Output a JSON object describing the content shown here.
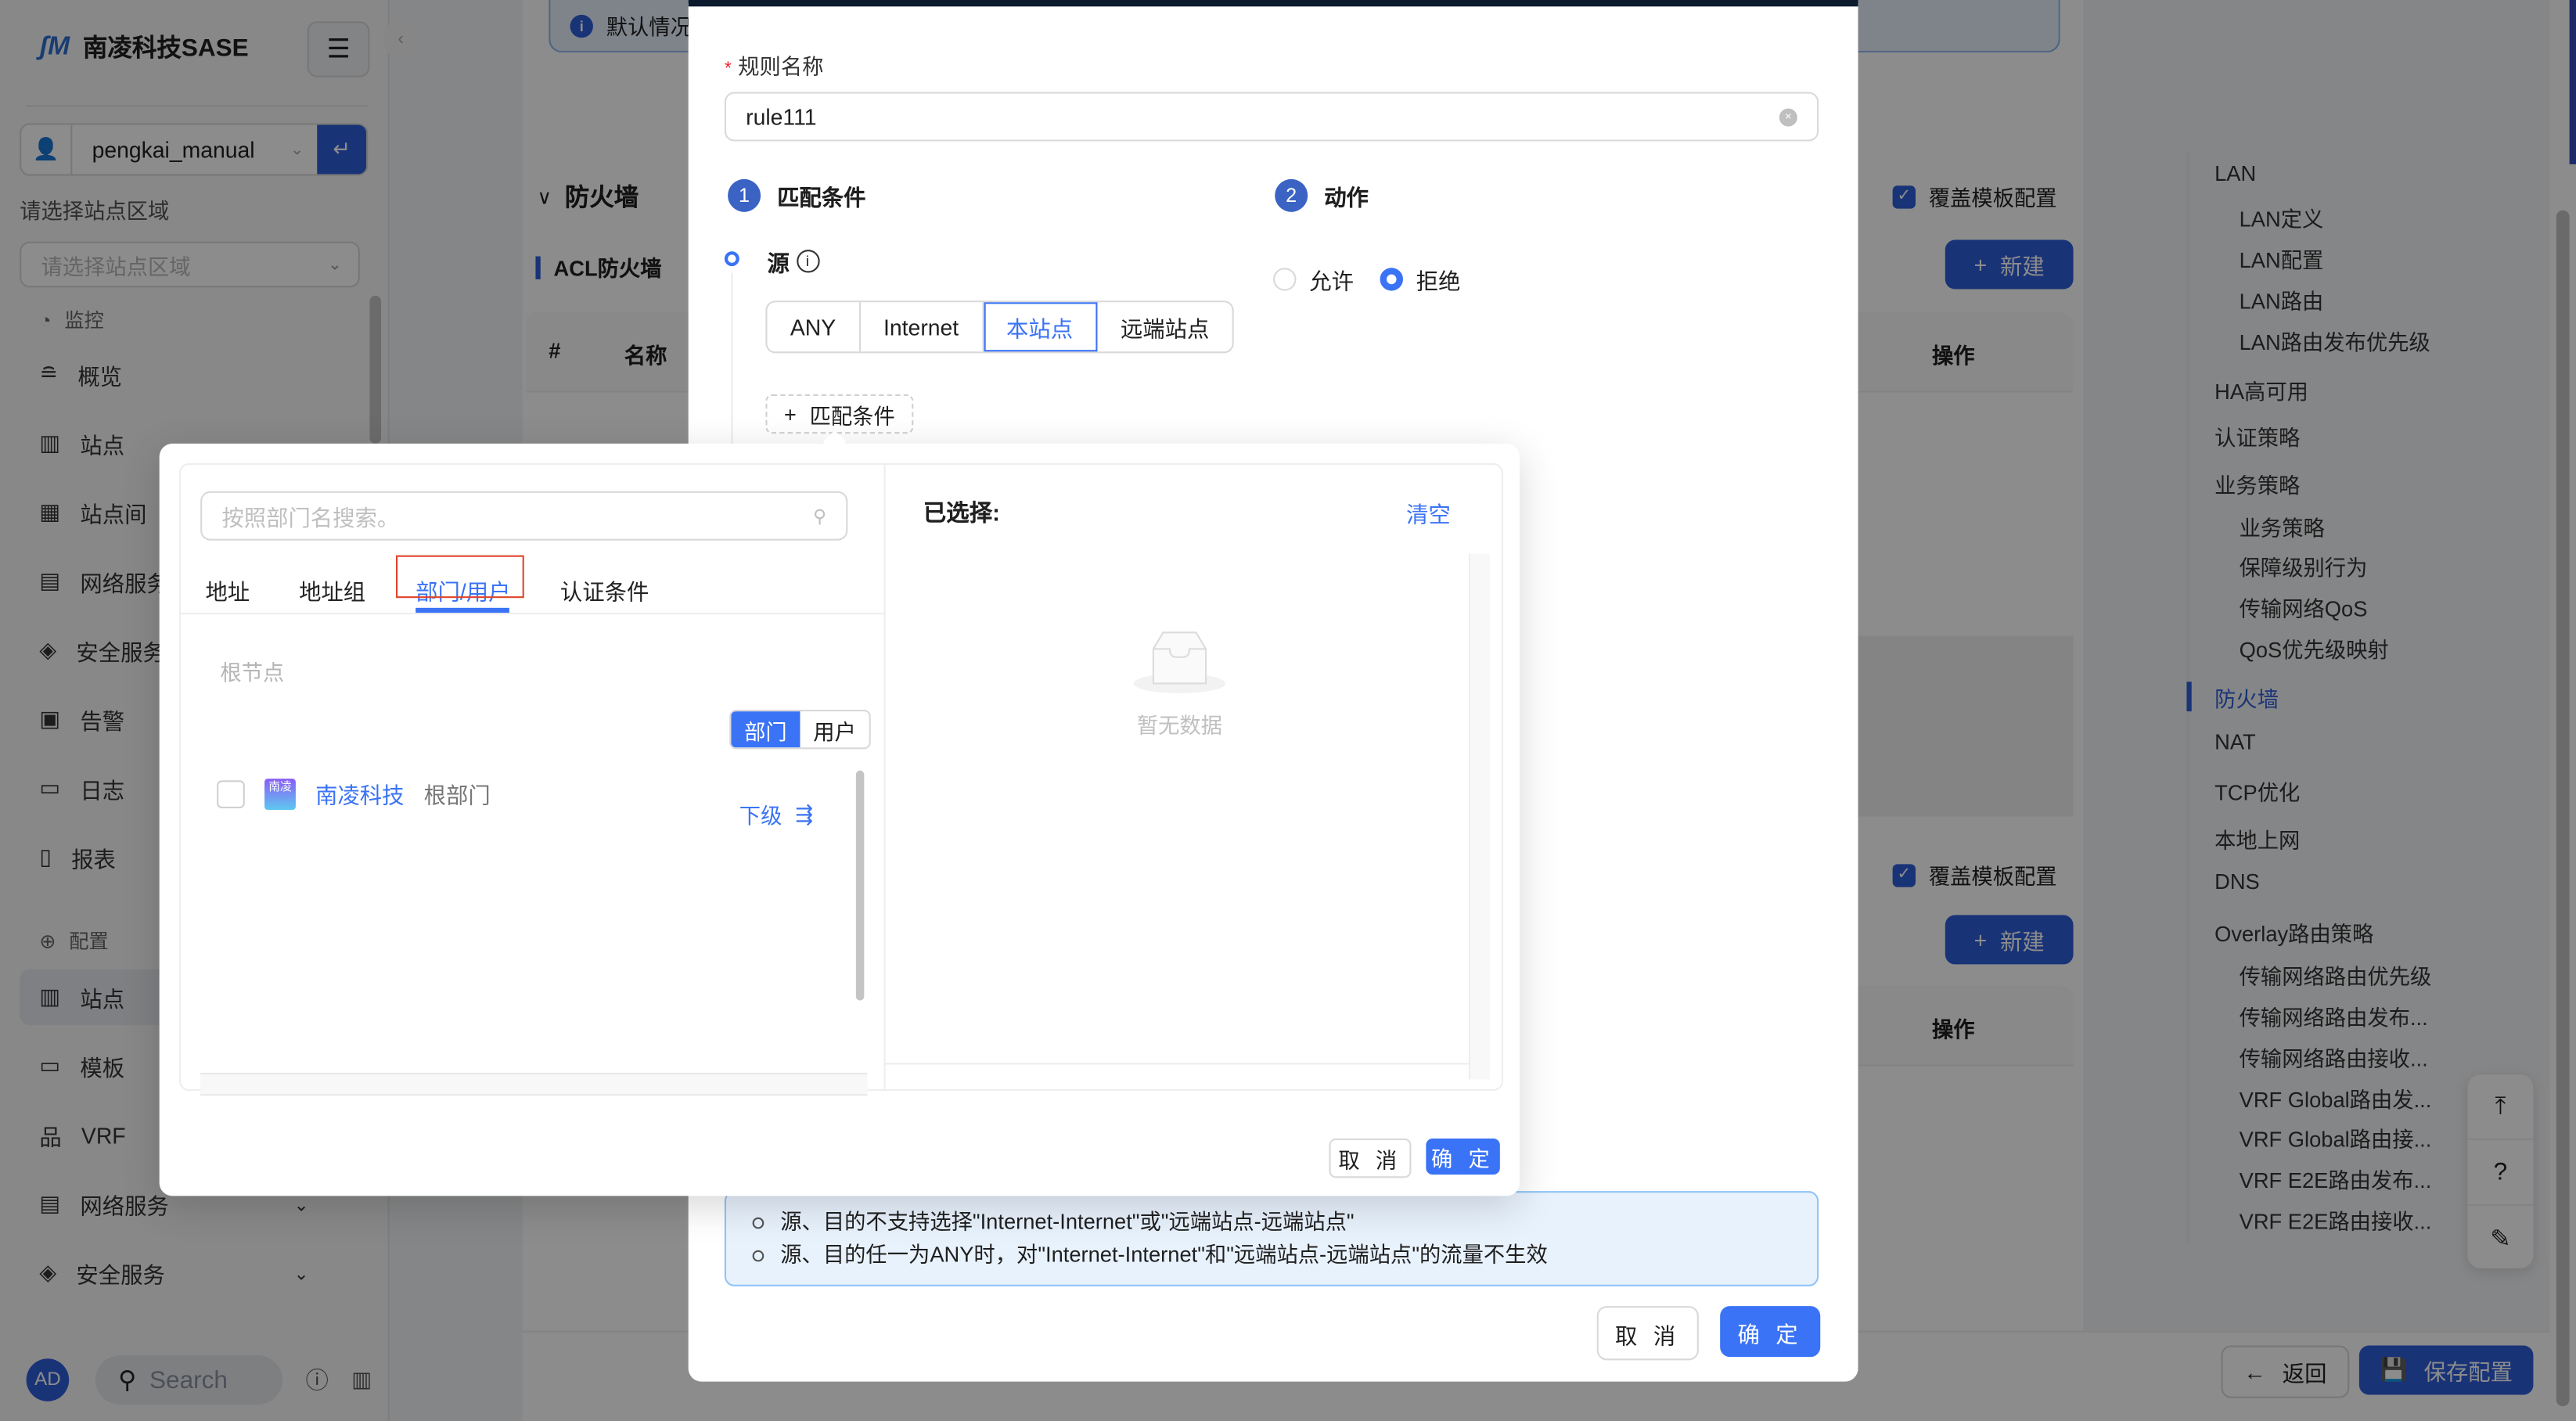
{
  "app": {
    "brand": "南凌科技SASE",
    "tenant": "pengkai_manual",
    "region_label": "请选择站点区域",
    "region_placeholder": "请选择站点区域",
    "collapse_icon": "chevron-left-icon"
  },
  "sidebar": {
    "groups": [
      {
        "title": "监控",
        "icon": "dashboard-icon",
        "items": [
          {
            "label": "概览",
            "icon": "overview-icon"
          },
          {
            "label": "站点",
            "icon": "building-icon"
          },
          {
            "label": "站点间",
            "icon": "buildings-icon"
          },
          {
            "label": "网络服务",
            "icon": "server-icon"
          },
          {
            "label": "安全服务",
            "icon": "shield-icon"
          },
          {
            "label": "告警",
            "icon": "alert-icon"
          },
          {
            "label": "日志",
            "icon": "log-icon"
          },
          {
            "label": "报表",
            "icon": "report-icon"
          }
        ]
      },
      {
        "title": "配置",
        "icon": "target-icon",
        "items": [
          {
            "label": "站点",
            "icon": "building-icon",
            "active": true
          },
          {
            "label": "模板",
            "icon": "template-icon"
          },
          {
            "label": "VRF",
            "icon": "network-icon"
          },
          {
            "label": "网络服务",
            "icon": "server-icon",
            "expandable": true
          },
          {
            "label": "安全服务",
            "icon": "shield-icon",
            "expandable": true
          }
        ]
      }
    ],
    "footer": {
      "avatar": "AD",
      "search_placeholder": "Search"
    }
  },
  "background": {
    "info_banner": "默认情况",
    "section_title": "防火墙",
    "subsection_title": "ACL防火墙",
    "table_columns": [
      "#",
      "名称",
      "操作"
    ],
    "cover_template_label": "覆盖模板配置",
    "new_button": "新建",
    "back_button": "返回",
    "save_button": "保存配置"
  },
  "anchor_nav": [
    {
      "label": "LAN",
      "level": 1
    },
    {
      "label": "LAN定义",
      "level": 2
    },
    {
      "label": "LAN配置",
      "level": 2
    },
    {
      "label": "LAN路由",
      "level": 2
    },
    {
      "label": "LAN路由发布优先级",
      "level": 2
    },
    {
      "label": "HA高可用",
      "level": 1
    },
    {
      "label": "认证策略",
      "level": 1
    },
    {
      "label": "业务策略",
      "level": 1
    },
    {
      "label": "业务策略",
      "level": 2
    },
    {
      "label": "保障级别行为",
      "level": 2
    },
    {
      "label": "传输网络QoS",
      "level": 2
    },
    {
      "label": "QoS优先级映射",
      "level": 2
    },
    {
      "label": "防火墙",
      "level": 1,
      "active": true
    },
    {
      "label": "NAT",
      "level": 1
    },
    {
      "label": "TCP优化",
      "level": 1
    },
    {
      "label": "本地上网",
      "level": 1
    },
    {
      "label": "DNS",
      "level": 1
    },
    {
      "label": "Overlay路由策略",
      "level": 1
    },
    {
      "label": "传输网络路由优先级",
      "level": 2
    },
    {
      "label": "传输网络路由发布...",
      "level": 2
    },
    {
      "label": "传输网络路由接收...",
      "level": 2
    },
    {
      "label": "VRF Global路由发...",
      "level": 2
    },
    {
      "label": "VRF Global路由接...",
      "level": 2
    },
    {
      "label": "VRF E2E路由发布...",
      "level": 2
    },
    {
      "label": "VRF E2E路由接收...",
      "level": 2
    }
  ],
  "modal": {
    "rule_name_label": "规则名称",
    "rule_name_value": "rule111",
    "step1": {
      "num": "1",
      "title": "匹配条件"
    },
    "step2": {
      "num": "2",
      "title": "动作"
    },
    "source_label": "源",
    "source_options": [
      "ANY",
      "Internet",
      "本站点",
      "远端站点"
    ],
    "source_selected": "本站点",
    "add_condition": "匹配条件",
    "actions": [
      {
        "label": "允许",
        "checked": false
      },
      {
        "label": "拒绝",
        "checked": true
      }
    ],
    "notes": [
      "源、目的不支持选择\"Internet-Internet\"或\"远端站点-远端站点\"",
      "源、目的任一为ANY时，对\"Internet-Internet\"和\"远端站点-远端站点\"的流量不生效"
    ],
    "cancel": "取 消",
    "ok": "确 定"
  },
  "popover": {
    "search_placeholder": "按照部门名搜索。",
    "tabs": [
      "地址",
      "地址组",
      "部门/用户",
      "认证条件"
    ],
    "active_tab": "部门/用户",
    "breadcrumb_root": "根节点",
    "toggle": [
      "部门",
      "用户"
    ],
    "toggle_active": "部门",
    "departments": [
      {
        "logo": "南凌",
        "name": "南凌科技",
        "tag": "根部门",
        "children_link": "下级"
      }
    ],
    "selected_title": "已选择:",
    "clear": "清空",
    "empty_text": "暂无数据",
    "cancel": "取 消",
    "ok": "确 定"
  }
}
